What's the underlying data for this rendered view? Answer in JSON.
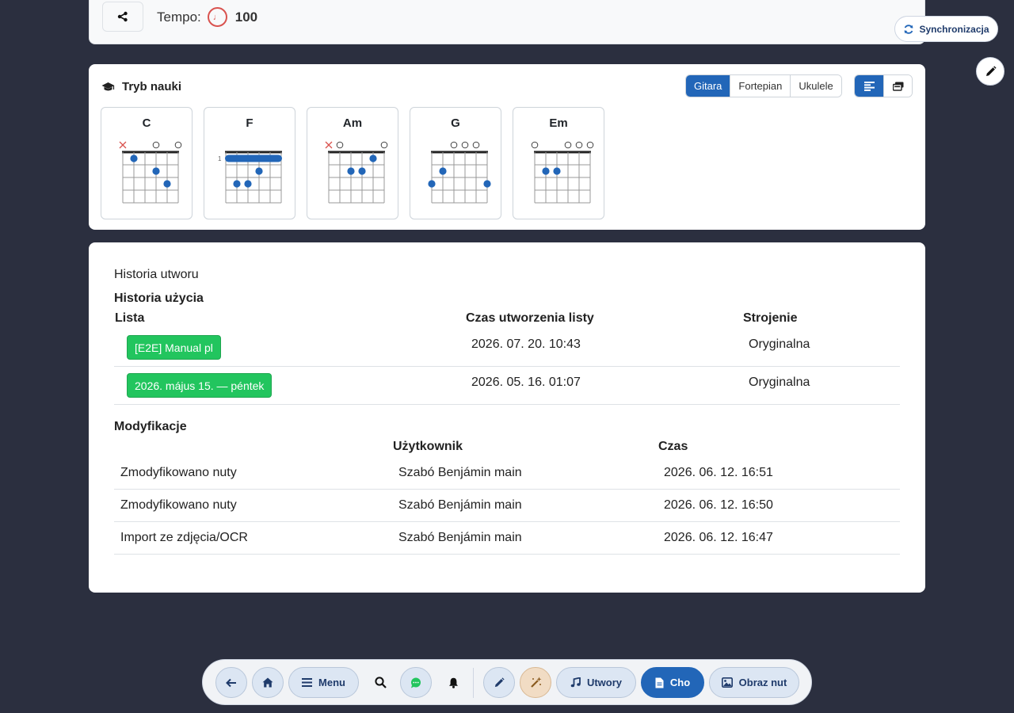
{
  "top": {
    "tempo_label": "Tempo:",
    "tempo_value": "100"
  },
  "sync_label": "Synchronizacja",
  "learn": {
    "title": "Tryb nauki",
    "instruments": [
      "Gitara",
      "Fortepian",
      "Ukulele"
    ],
    "active_instrument": "Gitara",
    "chords": [
      {
        "name": "C",
        "strings": [
          "x",
          "",
          "",
          "o",
          "",
          "o"
        ],
        "fret_label": "",
        "dots": [
          [
            5,
            3
          ],
          [
            4,
            2
          ],
          [
            2,
            1
          ]
        ],
        "barre": null
      },
      {
        "name": "F",
        "strings": [
          "",
          "",
          "",
          "",
          "",
          ""
        ],
        "fret_label": "1",
        "dots": [
          [
            2,
            3
          ],
          [
            3,
            3
          ],
          [
            4,
            2
          ]
        ],
        "barre": 1
      },
      {
        "name": "Am",
        "strings": [
          "x",
          "o",
          "",
          "",
          "",
          "o"
        ],
        "fret_label": "",
        "dots": [
          [
            3,
            2
          ],
          [
            4,
            2
          ],
          [
            5,
            1
          ]
        ],
        "barre": null
      },
      {
        "name": "G",
        "strings": [
          "",
          "",
          "o",
          "o",
          "o",
          ""
        ],
        "fret_label": "",
        "dots": [
          [
            1,
            3
          ],
          [
            2,
            2
          ],
          [
            6,
            3
          ]
        ],
        "barre": null
      },
      {
        "name": "Em",
        "strings": [
          "o",
          "",
          "",
          "o",
          "o",
          "o"
        ],
        "fret_label": "",
        "dots": [
          [
            2,
            2
          ],
          [
            3,
            2
          ]
        ],
        "barre": null
      }
    ]
  },
  "history": {
    "title": "Historia utworu",
    "usage_title": "Historia użycia",
    "usage_headers": [
      "Lista",
      "Czas utworzenia listy",
      "Strojenie"
    ],
    "usage_rows": [
      {
        "list": "[E2E] Manual pl",
        "time": "2026. 07. 20. 10:43",
        "tuning": "Oryginalna"
      },
      {
        "list": "2026. május 15. — péntek",
        "time": "2026. 05. 16. 01:07",
        "tuning": "Oryginalna"
      }
    ],
    "mods_title": "Modyfikacje",
    "mods_headers": [
      "Użytkownik",
      "Czas"
    ],
    "mods_rows": [
      {
        "action": "Zmodyfikowano nuty",
        "user": "Szabó Benjámin main",
        "time": "2026. 06. 12. 16:51"
      },
      {
        "action": "Zmodyfikowano nuty",
        "user": "Szabó Benjámin main",
        "time": "2026. 06. 12. 16:50"
      },
      {
        "action": "Import ze zdjęcia/OCR",
        "user": "Szabó Benjámin main",
        "time": "2026. 06. 12. 16:47"
      }
    ]
  },
  "bottom_bar": {
    "menu_label": "Menu",
    "songs_label": "Utwory",
    "cho_label": "Cho",
    "image_label": "Obraz nut"
  }
}
